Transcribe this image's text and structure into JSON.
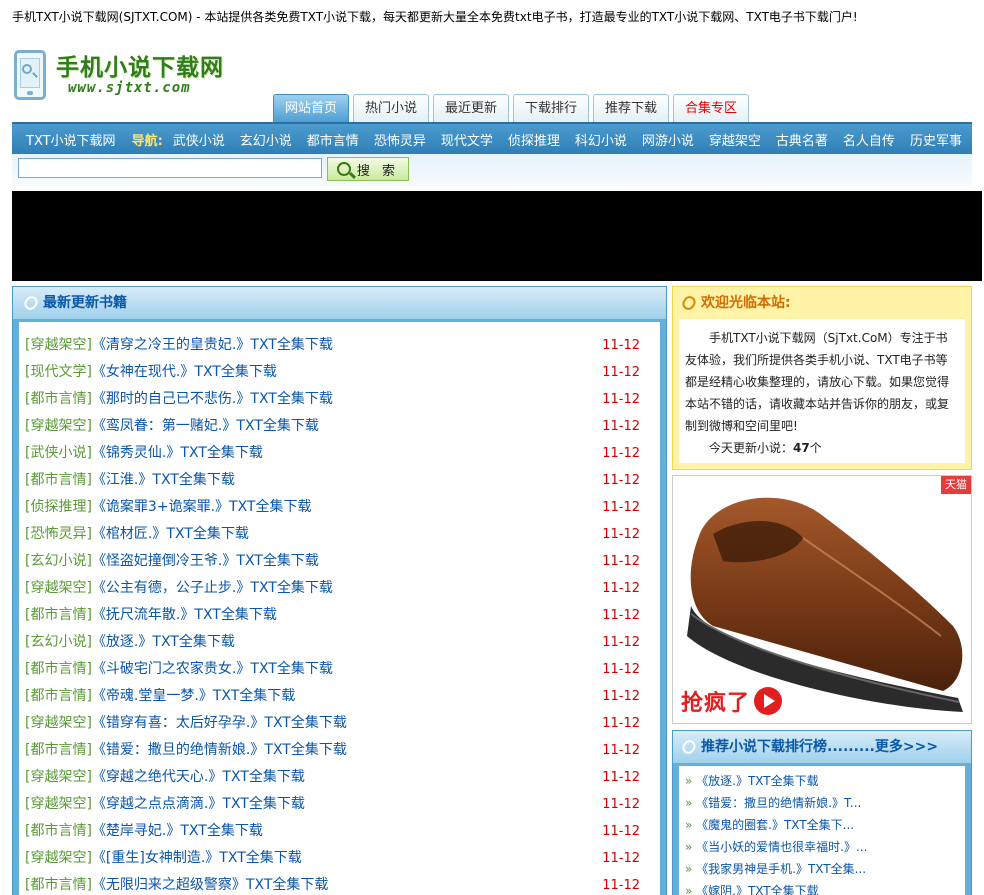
{
  "header": {
    "banner": "手机TXT小说下载网(SJTXT.COM) - 本站提供各类免费TXT小说下载，每天都更新大量全本免费txt电子书，打造最专业的TXT小说下载网、TXT电子书下载门户!",
    "logo_title": "手机小说下载网",
    "logo_url": "www.sjtxt.com"
  },
  "tabs": [
    {
      "label": "网站首页"
    },
    {
      "label": "热门小说"
    },
    {
      "label": "最近更新"
    },
    {
      "label": "下载排行"
    },
    {
      "label": "推荐下载"
    },
    {
      "label": "合集专区"
    }
  ],
  "nav": {
    "site": "TXT小说下载网",
    "label": "导航:",
    "links": [
      "武侠小说",
      "玄幻小说",
      "都市言情",
      "恐怖灵异",
      "现代文学",
      "侦探推理",
      "科幻小说",
      "网游小说",
      "穿越架空",
      "古典名著",
      "名人自传",
      "历史军事"
    ]
  },
  "search": {
    "placeholder": "",
    "button": "搜 索"
  },
  "latest": {
    "title": "最新更新书籍",
    "books": [
      {
        "cat": "[穿越架空]",
        "name": "《清穿之冷王的皇贵妃.》TXT全集下载",
        "date": "11-12"
      },
      {
        "cat": "[现代文学]",
        "name": "《女神在现代.》TXT全集下载",
        "date": "11-12"
      },
      {
        "cat": "[都市言情]",
        "name": "《那时的自己已不悲伤.》TXT全集下载",
        "date": "11-12"
      },
      {
        "cat": "[穿越架空]",
        "name": "《鸾凤眷：第一赌妃.》TXT全集下载",
        "date": "11-12"
      },
      {
        "cat": "[武侠小说]",
        "name": "《锦秀灵仙.》TXT全集下载",
        "date": "11-12"
      },
      {
        "cat": "[都市言情]",
        "name": "《江淮.》TXT全集下载",
        "date": "11-12"
      },
      {
        "cat": "[侦探推理]",
        "name": "《诡案罪3+诡案罪.》TXT全集下载",
        "date": "11-12"
      },
      {
        "cat": "[恐怖灵异]",
        "name": "《棺材匠.》TXT全集下载",
        "date": "11-12"
      },
      {
        "cat": "[玄幻小说]",
        "name": "《怪盗妃撞倒冷王爷.》TXT全集下载",
        "date": "11-12"
      },
      {
        "cat": "[穿越架空]",
        "name": "《公主有德，公子止步.》TXT全集下载",
        "date": "11-12"
      },
      {
        "cat": "[都市言情]",
        "name": "《抚尺流年散.》TXT全集下载",
        "date": "11-12"
      },
      {
        "cat": "[玄幻小说]",
        "name": "《放逐.》TXT全集下载",
        "date": "11-12"
      },
      {
        "cat": "[都市言情]",
        "name": "《斗破宅门之农家贵女.》TXT全集下载",
        "date": "11-12"
      },
      {
        "cat": "[都市言情]",
        "name": "《帝魂.堂皇一梦.》TXT全集下载",
        "date": "11-12"
      },
      {
        "cat": "[穿越架空]",
        "name": "《错穿有喜：太后好孕孕.》TXT全集下载",
        "date": "11-12"
      },
      {
        "cat": "[都市言情]",
        "name": "《错爱：撒旦的绝情新娘.》TXT全集下载",
        "date": "11-12"
      },
      {
        "cat": "[穿越架空]",
        "name": "《穿越之绝代天心.》TXT全集下载",
        "date": "11-12"
      },
      {
        "cat": "[穿越架空]",
        "name": "《穿越之点点滴滴.》TXT全集下载",
        "date": "11-12"
      },
      {
        "cat": "[都市言情]",
        "name": "《楚岸寻妃.》TXT全集下载",
        "date": "11-12"
      },
      {
        "cat": "[穿越架空]",
        "name": "《[重生]女神制造.》TXT全集下载",
        "date": "11-12"
      },
      {
        "cat": "[都市言情]",
        "name": "《无限归来之超级警察》TXT全集下载",
        "date": "11-12"
      }
    ]
  },
  "welcome": {
    "title": "欢迎光临本站:",
    "text": "手机TXT小说下载网（SjTxt.CoM）专注于书友体验，我们所提供各类手机小说、TXT电子书等都是经精心收集整理的，请放心下载。如果您觉得本站不错的话，请收藏本站并告诉你的朋友，或复制到微博和空间里吧!",
    "today_label": "今天更新小说：",
    "today_count": "47",
    "today_unit": "个"
  },
  "ad": {
    "badge": "天猫",
    "promo": "抢疯了"
  },
  "rank": {
    "title": "推荐小说下载排行榜.........更多>>>",
    "items": [
      "《放逐.》TXT全集下载",
      "《错爱：撒旦的绝情新娘.》T...",
      "《魔鬼的圈套.》TXT全集下...",
      "《当小妖的爱情也很幸福时.》...",
      "《我家男神是手机.》TXT全集...",
      "《嫁阴.》TXT全集下载"
    ]
  },
  "colors": {
    "nav_blue": "#2f7eb5",
    "category_green": "#5a9a36",
    "title_blue": "#0b56a8",
    "date_red": "#d40000",
    "welcome_yellow": "#fff3a8"
  }
}
